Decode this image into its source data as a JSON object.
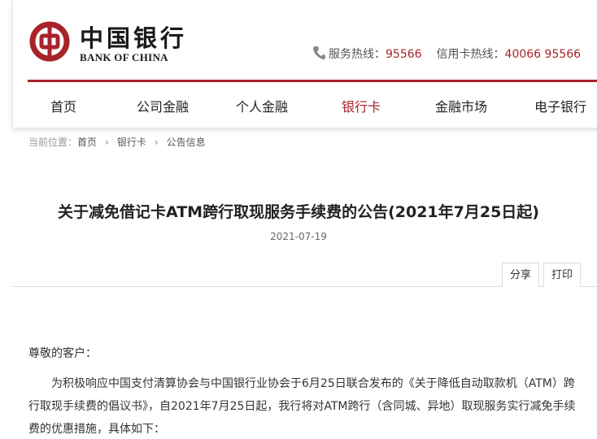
{
  "header": {
    "logo_cn": "中国银行",
    "logo_en": "BANK OF CHINA",
    "service_label": "服务热线：",
    "service_number": "95566",
    "card_label": "信用卡热线：",
    "card_number": "40066 95566",
    "brand_color": "#a8232a"
  },
  "nav": {
    "items": [
      "首页",
      "公司金融",
      "个人金融",
      "银行卡",
      "金融市场",
      "电子银行"
    ],
    "active": "银行卡"
  },
  "breadcrumb": {
    "label": "当前位置：",
    "items": [
      "首页",
      "银行卡",
      "公告信息"
    ]
  },
  "article": {
    "title": "关于减免借记卡ATM跨行取现服务手续费的公告(2021年7月25日起)",
    "date": "2021-07-19",
    "share_label": "分享",
    "print_label": "打印",
    "greeting": "尊敬的客户：",
    "para1": "为积极响应中国支付清算协会与中国银行业协会于6月25日联合发布的《关于降低自动取款机（ATM）跨行取现手续费的倡议书》，自2021年7月25日起，我行将对ATM跨行（含同城、异地）取现服务实行减免手续费的优惠措施，具体如下："
  }
}
